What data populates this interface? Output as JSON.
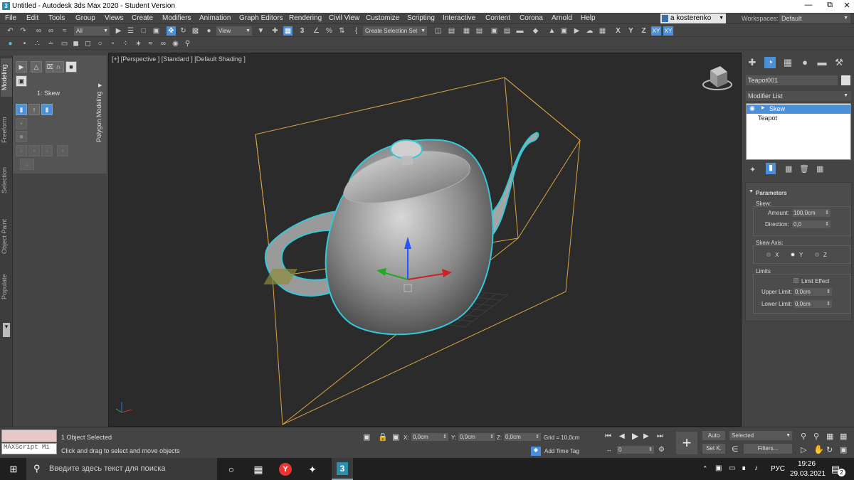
{
  "window": {
    "title": "Untitled - Autodesk 3ds Max 2020 - Student Version",
    "app_icon": "3"
  },
  "menu": [
    "File",
    "Edit",
    "Tools",
    "Group",
    "Views",
    "Create",
    "Modifiers",
    "Animation",
    "Graph Editors",
    "Rendering",
    "Civil View",
    "Customize",
    "Scripting",
    "Interactive",
    "Content",
    "Corona",
    "Arnold",
    "Help"
  ],
  "user": {
    "name": "a kosterenko"
  },
  "workspaces": {
    "label": "Workspaces:",
    "value": "Default"
  },
  "toolbar": {
    "filter": "All",
    "ref_coord": "View",
    "snap_label": "3",
    "named_selection": "Create Selection Set",
    "axis_x": "X",
    "axis_y": "Y",
    "axis_z": "Z",
    "axis_xy": "XY",
    "axis_xy2": "XY"
  },
  "left_tabs": [
    "Modeling",
    "Freeform",
    "Selection",
    "Object Paint",
    "Populate"
  ],
  "ribbon": {
    "modifier_label": "1: Skew",
    "polygon_tab": "Polygon Modeling"
  },
  "viewport": {
    "label": "[+] [Perspective ] [Standard ] [Default Shading ]"
  },
  "command_panel": {
    "object_name": "Teapot001",
    "modifier_list_label": "Modifier List",
    "stack": [
      {
        "name": "Skew",
        "selected": true
      },
      {
        "name": "Teapot",
        "selected": false
      }
    ],
    "rollout_title": "Parameters",
    "skew_label": "Skew:",
    "amount_label": "Amount:",
    "amount_value": "100,0cm",
    "direction_label": "Direction:",
    "direction_value": "0,0",
    "skew_axis_label": "Skew Axis:",
    "axis_x": "X",
    "axis_y": "Y",
    "axis_z": "Z",
    "selected_axis": "Y",
    "limits_label": "Limits",
    "limit_effect_label": "Limit Effect",
    "upper_limit_label": "Upper Limit:",
    "upper_limit_value": "0,0cm",
    "lower_limit_label": "Lower Limit:",
    "lower_limit_value": "0,0cm"
  },
  "status": {
    "script_label": "MAXScript Mi",
    "selected": "1 Object Selected",
    "prompt": "Click and drag to select and move objects",
    "x_label": "X:",
    "x_value": "0,0cm",
    "y_label": "Y:",
    "y_value": "0,0cm",
    "z_label": "Z:",
    "z_value": "0,0cm",
    "grid": "Grid = 10,0cm",
    "add_time_tag": "Add Time Tag",
    "frame": "0",
    "auto_key": "Auto",
    "set_key": "Set K.",
    "selected_dd": "Selected",
    "filters": "Filters..."
  },
  "taskbar": {
    "search_placeholder": "Введите здесь текст для поиска",
    "lang": "РУС",
    "time": "19:26",
    "date": "29.03.2021",
    "notif_count": "2",
    "max_icon": "3"
  },
  "colors": {
    "accent": "#4a90d9",
    "bbox": "#d9a441",
    "highlight": "#33c8d8"
  }
}
